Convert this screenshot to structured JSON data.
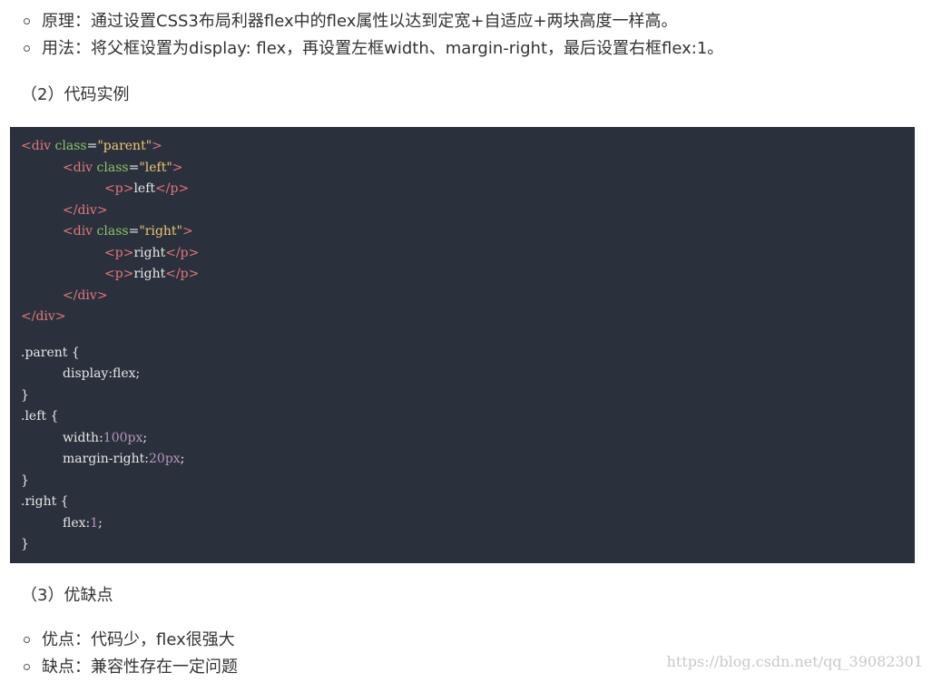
{
  "list1": [
    "原理：通过设置CSS3布局利器flex中的flex属性以达到定宽+自适应+两块高度一样高。",
    "用法：将父框设置为display: flex，再设置左框width、margin-right，最后设置右框flex:1。"
  ],
  "headings": {
    "code": "（2）代码实例",
    "pros": "（3）优缺点"
  },
  "code": {
    "tag_open_lt": "<",
    "tag_close_gt": ">",
    "tag_end_lt": "</",
    "div": "div",
    "p": "p",
    "class_attr": "class",
    "eq": "=",
    "parent_str": "\"parent\"",
    "left_str": "\"left\"",
    "right_str": "\"right\"",
    "left_text": "left",
    "right_text": "right",
    "css_parent_sel": ".parent {",
    "css_display": "display:flex;",
    "close_brace": "}",
    "css_left_sel": ".left {",
    "css_width_prop": "width:",
    "css_width_val": "100px",
    "css_margin_prop": "margin-right:",
    "css_margin_val": "20px",
    "semicolon": ";",
    "css_right_sel": ".right {",
    "css_flex_prop": "flex:",
    "css_flex_val": "1"
  },
  "list2": [
    "优点：代码少，flex很强大",
    "缺点：兼容性存在一定问题"
  ],
  "watermark": "https://blog.csdn.net/qq_39082301",
  "colors": {
    "code_background": "#2b313c",
    "tag": "#e2777a",
    "attribute": "#8fc16a",
    "string": "#f0c674",
    "number": "#b294bb"
  }
}
